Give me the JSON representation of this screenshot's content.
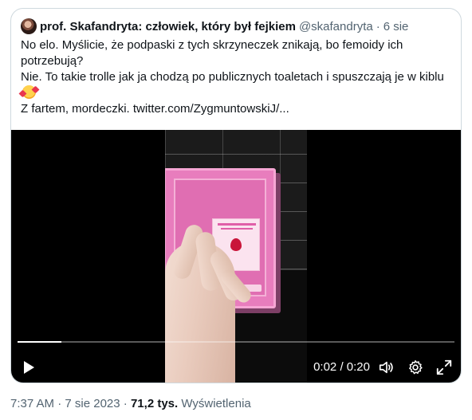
{
  "quoted_tweet": {
    "author_name": "prof. Skafandryta: człowiek, który był fejkiem",
    "author_handle": "@skafandryta",
    "separator": "·",
    "time": "6 sie",
    "text_lines": [
      "No elo. Myślicie, że podpaski z tych skrzyneczek znikają, bo femoidy ich potrzebują?",
      "Nie. To takie trolle jak ja chodzą po publicznych toaletach i spuszczają je w kiblu",
      "Z fartem, mordeczki.  twitter.com/ZygmuntowskiJ/..."
    ],
    "emoji": "smiling-face-with-hearts"
  },
  "video": {
    "progress": 0.1,
    "current_time": "0:02",
    "time_separator": " / ",
    "duration": "0:20",
    "play_icon": "play-icon",
    "volume_icon": "volume-icon",
    "settings_icon": "gear-icon",
    "fullscreen_icon": "fullscreen-icon"
  },
  "footer": {
    "time": "7:37 AM",
    "separator": "·",
    "date": "7 sie 2023",
    "views_count": "71,2 tys.",
    "views_label": "Wyświetlenia"
  }
}
